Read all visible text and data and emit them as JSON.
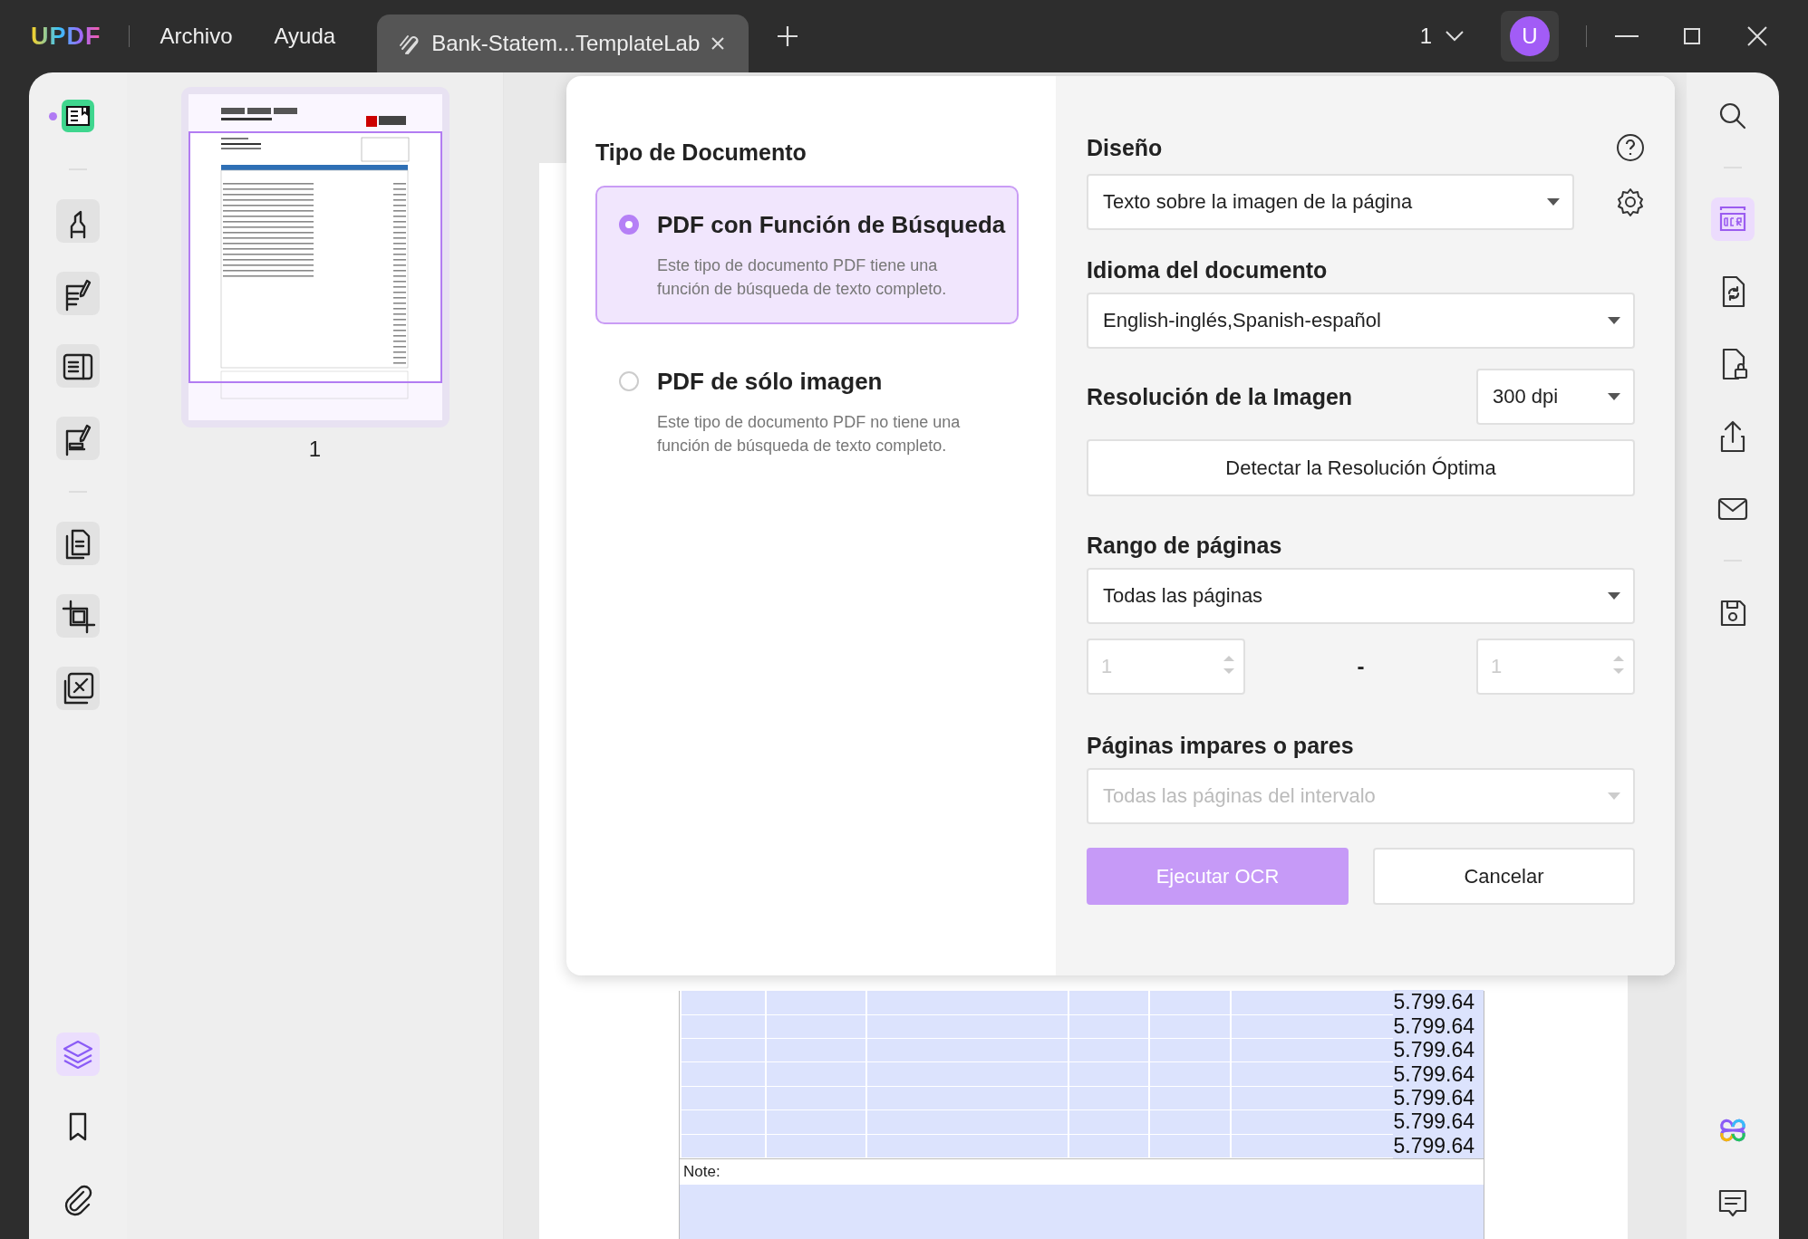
{
  "app": {
    "logo": "UPDF",
    "menu": [
      {
        "label": "Archivo"
      },
      {
        "label": "Ayuda"
      }
    ]
  },
  "tabs": [
    {
      "label": "Bank-Statem...TemplateLab",
      "selected": true
    }
  ],
  "window": {
    "page_indicator": "1",
    "avatar": "U"
  },
  "left_toolbar": {
    "tools": [
      {
        "selected": true
      },
      {
        "selected": false
      },
      {
        "selected": false
      },
      {
        "selected": false
      },
      {
        "selected": false
      },
      {
        "selected": false
      },
      {
        "selected": false
      },
      {
        "selected": false
      }
    ],
    "bottom_tools": [
      {
        "selected": true
      },
      {
        "selected": false
      },
      {
        "selected": false
      }
    ]
  },
  "thumbnails": [
    {
      "label": "1",
      "selected": true
    }
  ],
  "document": {
    "rows": [
      {
        "balance": "5.799.64"
      },
      {
        "balance": "5.799.64"
      },
      {
        "balance": "5.799.64"
      },
      {
        "balance": "5.799.64"
      },
      {
        "balance": "5.799.64"
      },
      {
        "balance": "5.799.64"
      },
      {
        "balance": "5.799.64"
      }
    ],
    "note_label": "Note:"
  },
  "ocr_dialog": {
    "document_type": {
      "title": "Tipo de Documento",
      "options": [
        {
          "title": "PDF con Función de Búsqueda",
          "description": "Este tipo de documento PDF tiene una función de búsqueda de texto completo.",
          "selected": true
        },
        {
          "title": "PDF de sólo imagen",
          "description": "Este tipo de documento PDF no tiene una función de búsqueda de texto completo.",
          "selected": false
        }
      ]
    },
    "layout": {
      "label": "Diseño",
      "value": "Texto sobre la imagen de la página"
    },
    "language": {
      "label": "Idioma del documento",
      "value": "English-inglés,Spanish-español"
    },
    "resolution": {
      "label": "Resolución de la Imagen",
      "value": "300 dpi",
      "detect_button": "Detectar la Resolución Óptima"
    },
    "page_range": {
      "label": "Rango de páginas",
      "value": "Todas las páginas",
      "from": {
        "placeholder": "1",
        "disabled": true
      },
      "separator": "-",
      "to": {
        "placeholder": "1",
        "disabled": true
      }
    },
    "odd_even": {
      "label": "Páginas impares o pares",
      "value": "Todas las páginas del intervalo",
      "disabled": true
    },
    "buttons": [
      {
        "label": "Ejecutar OCR",
        "kind": "primary"
      },
      {
        "label": "Cancelar",
        "kind": "secondary"
      }
    ]
  },
  "right_toolbar": {
    "tools": [
      {
        "selected": false
      },
      {
        "selected": true
      },
      {
        "selected": false
      },
      {
        "selected": false
      },
      {
        "selected": false
      },
      {
        "selected": false
      },
      {
        "selected": false
      }
    ],
    "bottom_tools": [
      {
        "selected": false
      },
      {
        "selected": false
      }
    ]
  }
}
